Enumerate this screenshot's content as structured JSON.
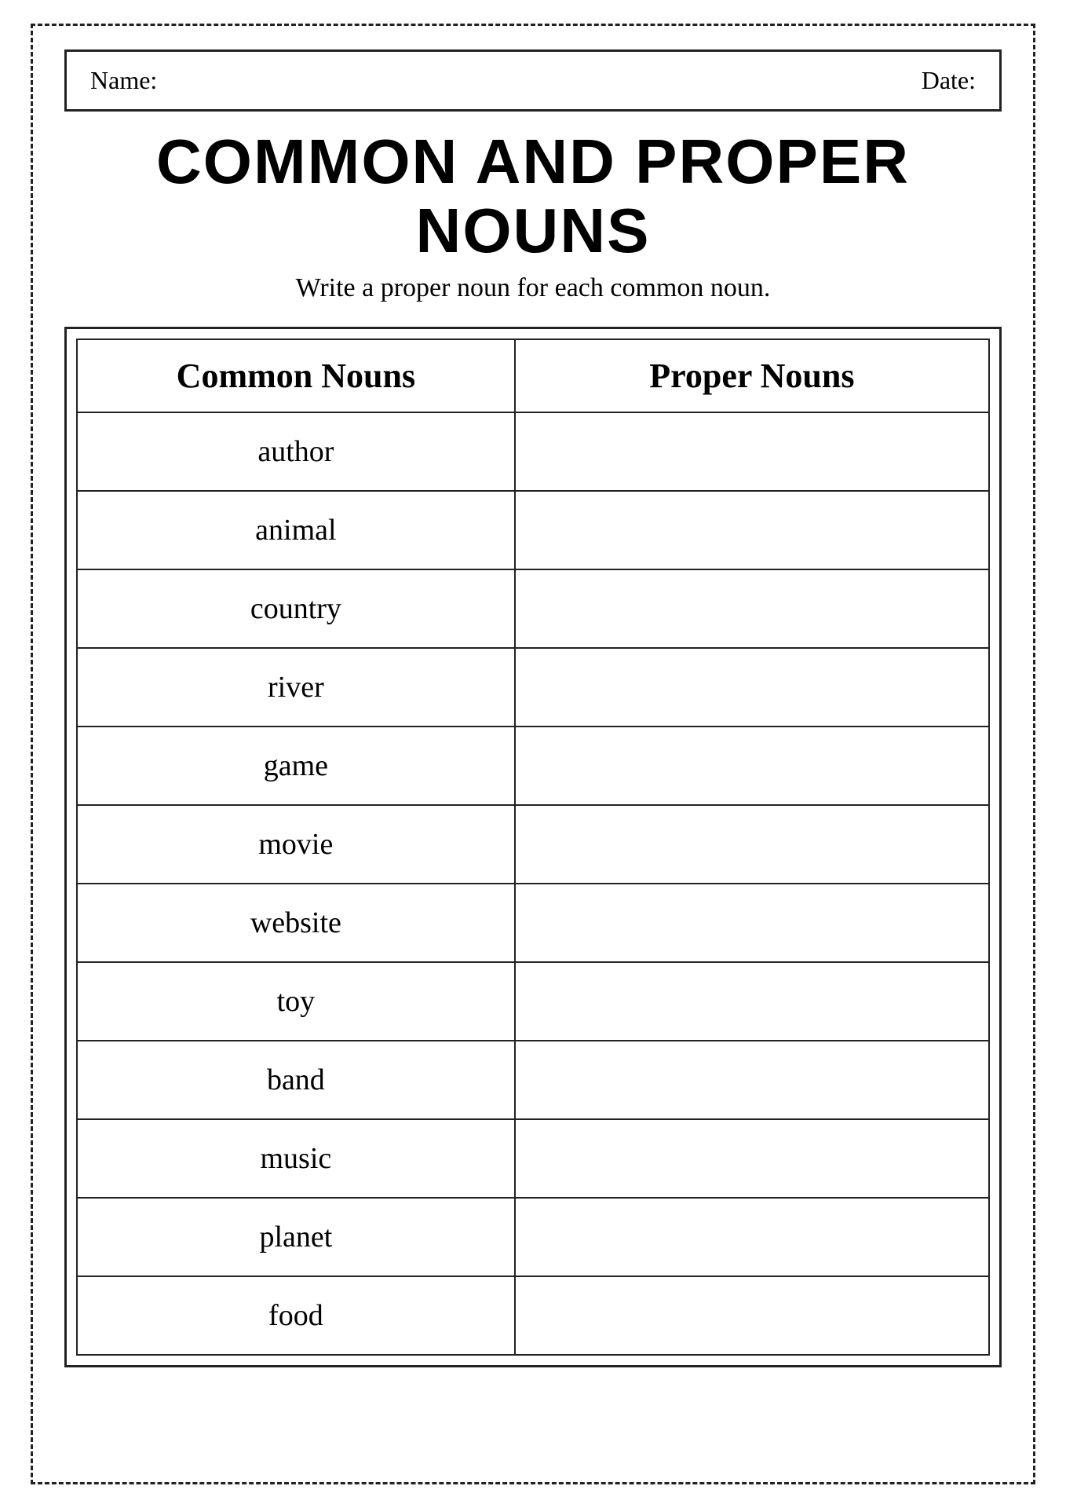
{
  "header": {
    "name_label": "Name:",
    "date_label": "Date:"
  },
  "title": "COMMON AND PROPER NOUNS",
  "subtitle": "Write a proper noun for each common noun.",
  "table": {
    "col1_header": "Common Nouns",
    "col2_header": "Proper Nouns",
    "rows": [
      {
        "common": "author",
        "proper": ""
      },
      {
        "common": "animal",
        "proper": ""
      },
      {
        "common": "country",
        "proper": ""
      },
      {
        "common": "river",
        "proper": ""
      },
      {
        "common": "game",
        "proper": ""
      },
      {
        "common": "movie",
        "proper": ""
      },
      {
        "common": "website",
        "proper": ""
      },
      {
        "common": "toy",
        "proper": ""
      },
      {
        "common": "band",
        "proper": ""
      },
      {
        "common": "music",
        "proper": ""
      },
      {
        "common": "planet",
        "proper": ""
      },
      {
        "common": "food",
        "proper": ""
      }
    ]
  }
}
